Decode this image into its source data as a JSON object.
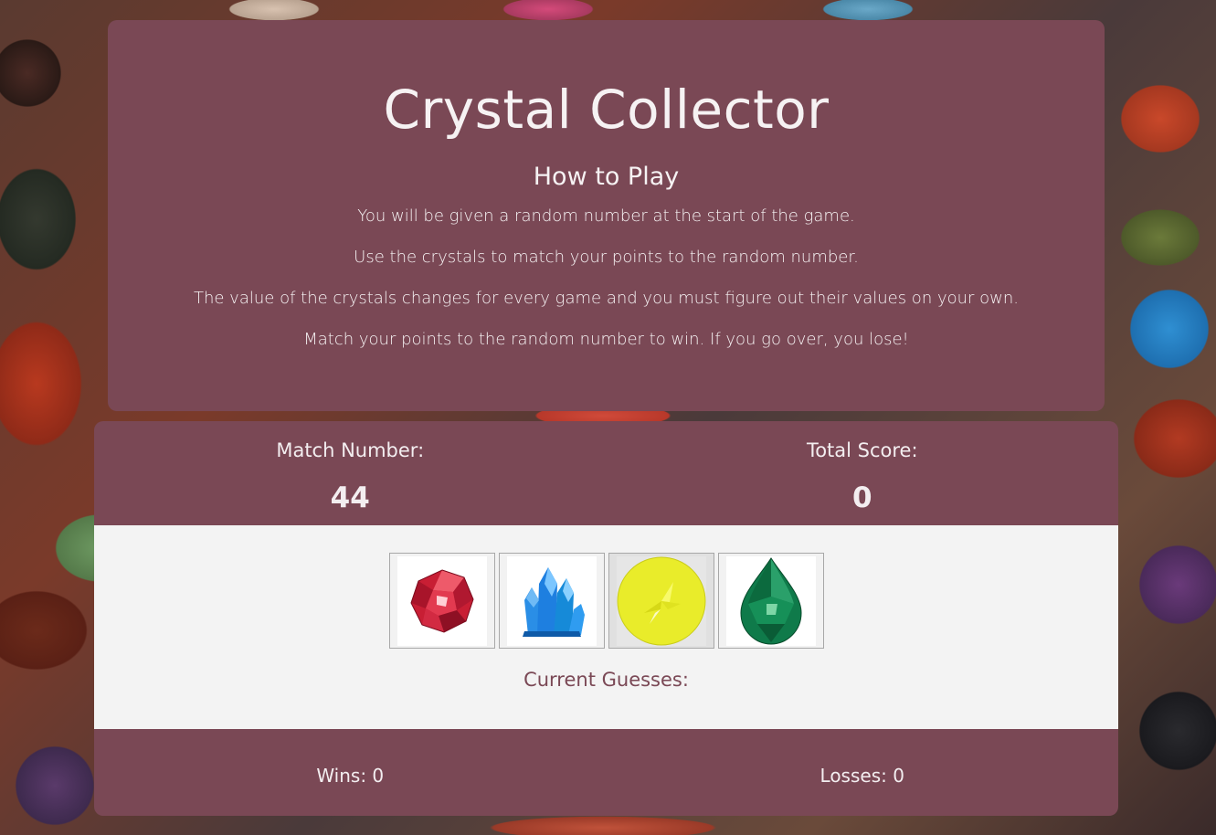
{
  "header": {
    "title": "Crystal Collector",
    "subtitle": "How to Play",
    "rules": [
      "You will be given a random number at the start of the game.",
      "Use the crystals to match your points to the random number.",
      "The value of the crystals changes for every game and you must figure out their values on your own.",
      "Match your points to the random number to win. If you go over, you lose!"
    ]
  },
  "scoreboard": {
    "match_label": "Match Number:",
    "match_value": "44",
    "total_label": "Total Score:",
    "total_value": "0"
  },
  "crystals": [
    {
      "icon": "red-gem-icon",
      "color": "#d8283a"
    },
    {
      "icon": "blue-crystal-cluster-icon",
      "color": "#1e8fe0"
    },
    {
      "icon": "yellow-round-gem-icon",
      "color": "#e8ec2e"
    },
    {
      "icon": "green-pear-gem-icon",
      "color": "#0f7a4a"
    }
  ],
  "guesses": {
    "label": "Current Guesses:"
  },
  "record": {
    "wins": "Wins: 0",
    "losses": "Losses: 0"
  },
  "colors": {
    "panel": "#7a4855",
    "light_panel": "#f3f3f3",
    "text_light": "#f3eef0"
  }
}
